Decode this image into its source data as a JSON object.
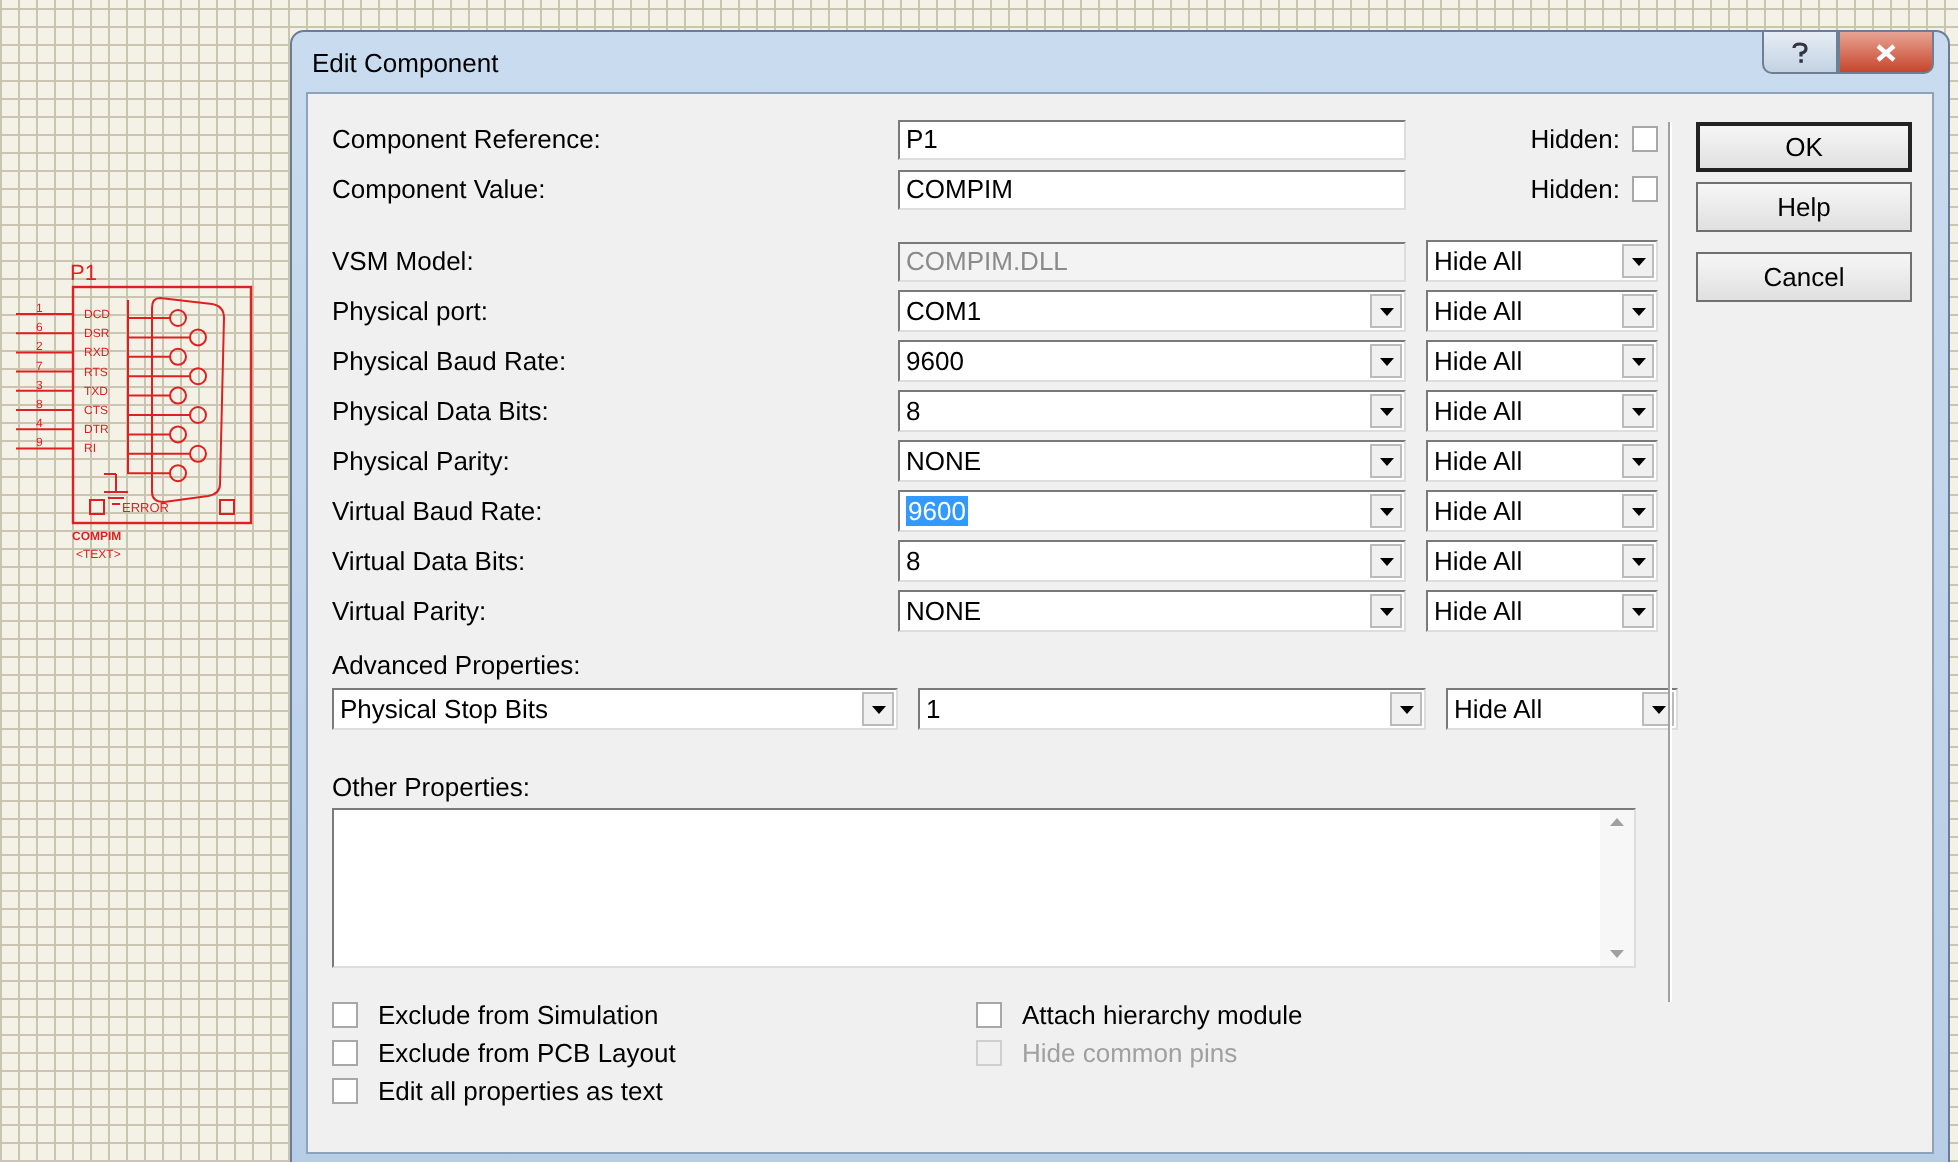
{
  "canvas": {
    "component": {
      "reference": "P1",
      "pins": [
        {
          "number": "1",
          "signal": "DCD"
        },
        {
          "number": "6",
          "signal": "DSR"
        },
        {
          "number": "2",
          "signal": "RXD"
        },
        {
          "number": "7",
          "signal": "RTS"
        },
        {
          "number": "3",
          "signal": "TXD"
        },
        {
          "number": "8",
          "signal": "CTS"
        },
        {
          "number": "4",
          "signal": "DTR"
        },
        {
          "number": "9",
          "signal": "RI"
        }
      ],
      "status_label": "ERROR",
      "value": "COMPIM",
      "text": "<TEXT>"
    }
  },
  "dialog": {
    "title": "Edit Component",
    "properties": [
      {
        "kind": "text",
        "label": "Component Reference:",
        "value": "P1",
        "hidden_label": "Hidden:",
        "hidden": false
      },
      {
        "kind": "text",
        "label": "Component Value:",
        "value": "COMPIM",
        "hidden_label": "Hidden:",
        "hidden": false
      },
      {
        "kind": "readonly",
        "label": "VSM Model:",
        "value": "COMPIM.DLL",
        "visibility": "Hide All",
        "selected": false
      },
      {
        "kind": "combo",
        "label": "Physical port:",
        "value": "COM1",
        "visibility": "Hide All",
        "selected": false
      },
      {
        "kind": "combo",
        "label": "Physical Baud Rate:",
        "value": "9600",
        "visibility": "Hide All",
        "selected": false
      },
      {
        "kind": "combo",
        "label": "Physical Data Bits:",
        "value": "8",
        "visibility": "Hide All",
        "selected": false
      },
      {
        "kind": "combo",
        "label": "Physical Parity:",
        "value": "NONE",
        "visibility": "Hide All",
        "selected": false
      },
      {
        "kind": "combo",
        "label": "Virtual Baud Rate:",
        "value": "9600",
        "visibility": "Hide All",
        "selected": true
      },
      {
        "kind": "combo",
        "label": "Virtual Data Bits:",
        "value": "8",
        "visibility": "Hide All",
        "selected": false
      },
      {
        "kind": "combo",
        "label": "Virtual Parity:",
        "value": "NONE",
        "visibility": "Hide All",
        "selected": false
      }
    ],
    "advanced": {
      "label": "Advanced Properties:",
      "property": "Physical Stop Bits",
      "value": "1",
      "visibility": "Hide All"
    },
    "other": {
      "label": "Other Properties:"
    },
    "checkboxes_left": [
      {
        "label": "Exclude from Simulation",
        "checked": false,
        "disabled": false
      },
      {
        "label": "Exclude from PCB Layout",
        "checked": false,
        "disabled": false
      },
      {
        "label": "Edit all properties as text",
        "checked": false,
        "disabled": false
      }
    ],
    "checkboxes_right": [
      {
        "label": "Attach hierarchy module",
        "checked": false,
        "disabled": false
      },
      {
        "label": "Hide common pins",
        "checked": false,
        "disabled": true
      }
    ],
    "buttons": [
      {
        "label": "OK",
        "default": true
      },
      {
        "label": "Help",
        "default": false
      },
      {
        "label": "Cancel",
        "default": false
      }
    ]
  }
}
